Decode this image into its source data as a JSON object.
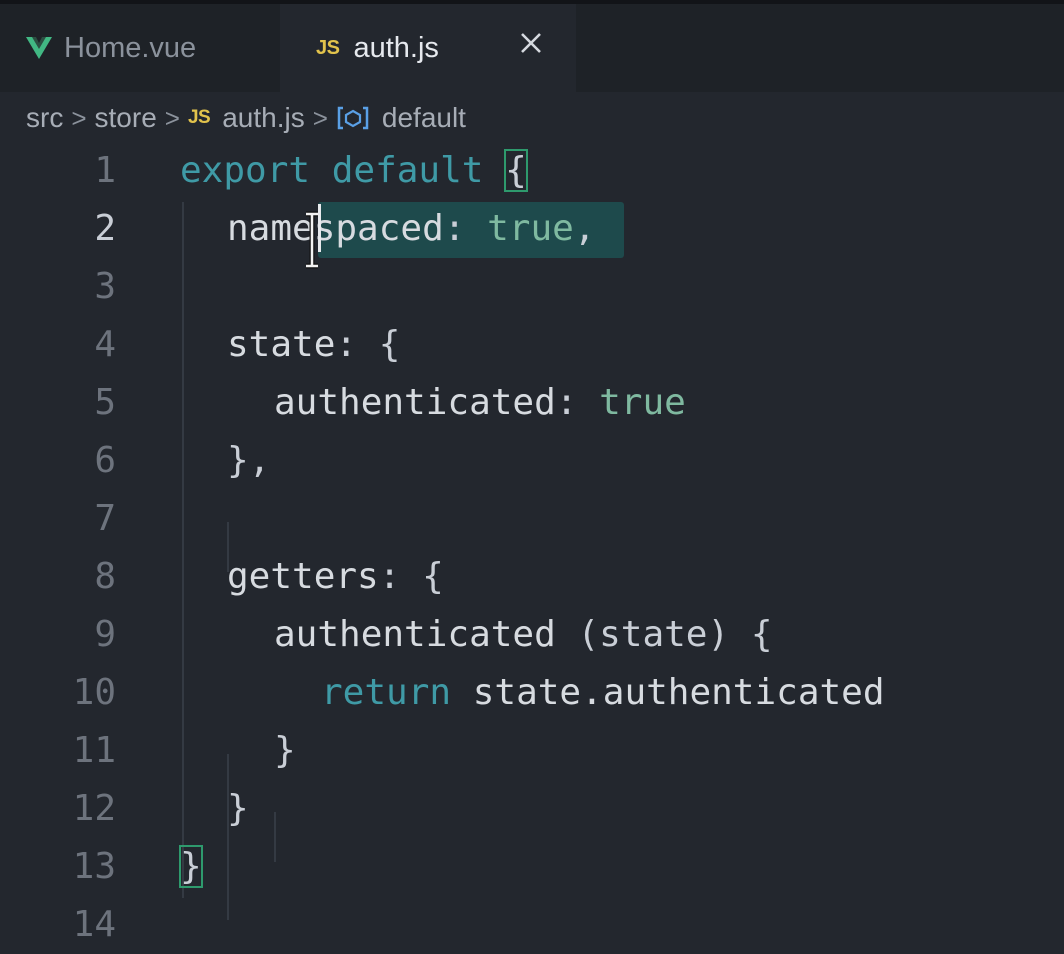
{
  "tabs": [
    {
      "label": "Home.vue",
      "icon": "vue-icon",
      "active": false
    },
    {
      "label": "auth.js",
      "icon": "js-icon",
      "active": true,
      "close": "close-icon"
    }
  ],
  "js_badge": "JS",
  "breadcrumb": {
    "parts": [
      "src",
      "store",
      "auth.js",
      "default"
    ],
    "separator": ">"
  },
  "editor": {
    "line_numbers": [
      "1",
      "2",
      "3",
      "4",
      "5",
      "6",
      "7",
      "8",
      "9",
      "10",
      "11",
      "12",
      "13",
      "14"
    ],
    "lines": [
      {
        "tokens": [
          {
            "t": "export",
            "c": "kw"
          },
          {
            "t": " "
          },
          {
            "t": "default",
            "c": "kw"
          },
          {
            "t": " "
          },
          {
            "t": "{",
            "c": "bracket"
          }
        ]
      },
      {
        "tokens": [
          {
            "t": "namespaced"
          },
          {
            "t": ": ",
            "c": "punc"
          },
          {
            "t": "true",
            "c": "bool"
          },
          {
            "t": ",",
            "c": "punc"
          }
        ]
      },
      {
        "tokens": []
      },
      {
        "tokens": [
          {
            "t": "state"
          },
          {
            "t": ": {",
            "c": "punc"
          }
        ]
      },
      {
        "tokens": [
          {
            "t": "authenticated"
          },
          {
            "t": ": ",
            "c": "punc"
          },
          {
            "t": "true",
            "c": "bool"
          }
        ]
      },
      {
        "tokens": [
          {
            "t": "},",
            "c": "punc"
          }
        ]
      },
      {
        "tokens": []
      },
      {
        "tokens": [
          {
            "t": "getters"
          },
          {
            "t": ": {",
            "c": "punc"
          }
        ]
      },
      {
        "tokens": [
          {
            "t": "authenticated"
          },
          {
            "t": " (state) {",
            "c": "punc"
          }
        ]
      },
      {
        "tokens": [
          {
            "t": "return",
            "c": "kw"
          },
          {
            "t": " state.authenticated"
          }
        ]
      },
      {
        "tokens": [
          {
            "t": "}",
            "c": "punc"
          }
        ]
      },
      {
        "tokens": [
          {
            "t": "}",
            "c": "punc"
          }
        ]
      },
      {
        "tokens": [
          {
            "t": "}",
            "c": "bracket"
          }
        ]
      },
      {
        "tokens": []
      }
    ]
  },
  "colors": {
    "background": "#23272e",
    "keyword": "#3f9aa6",
    "boolean": "#7fb9a0",
    "selection": "#1e4a4c",
    "js_icon": "#e2c34c",
    "vue_icon": "#41b883"
  }
}
